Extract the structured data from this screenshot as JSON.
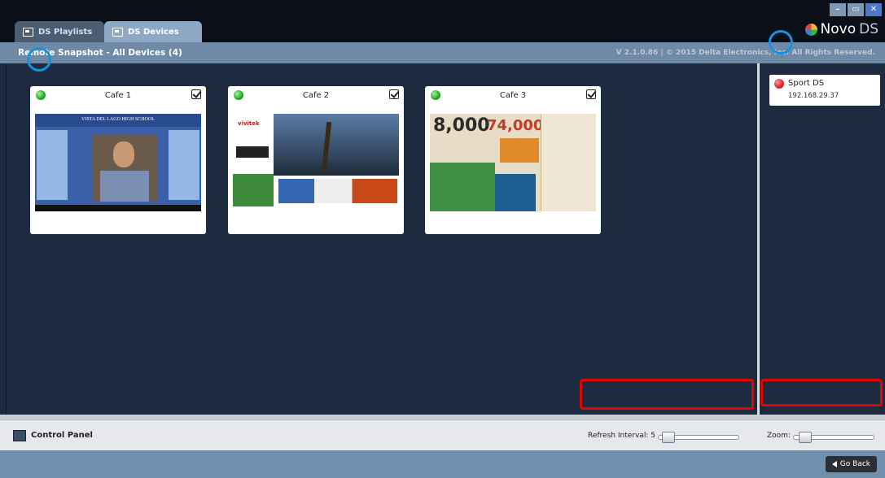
{
  "window": {
    "tabs": [
      {
        "label": "DS Playlists",
        "active": false
      },
      {
        "label": "DS Devices",
        "active": true
      }
    ],
    "logo": {
      "prefix": "Novo",
      "suffix": "DS"
    },
    "controls": {
      "minimize": "–",
      "maximize": "▭",
      "close": "✕"
    }
  },
  "header": {
    "title": "Remote Snapshot - All Devices (4)",
    "version": "V 2.1.0.86  |  © 2015 Delta Electronics, Inc. All Rights Reserved."
  },
  "devices": [
    {
      "name": "Cafe 1",
      "status": "online",
      "checked": true
    },
    {
      "name": "Cafe 2",
      "status": "online",
      "checked": true
    },
    {
      "name": "Cafe 3",
      "status": "online",
      "checked": true
    }
  ],
  "thumb_text": {
    "cafe1_band": "VISTA DEL LAGO HIGH SCHOOL",
    "cafe2_brand": "vivitek",
    "cafe3_big": "8,000",
    "cafe3_big2": "74,000"
  },
  "side_devices": [
    {
      "name": "Sport DS",
      "ip": "192.168.29.37",
      "status": "offline"
    }
  ],
  "control_panel": {
    "label": "Control Panel",
    "refresh_label": "Refresh Interval: 5",
    "refresh_value": 5,
    "zoom_label": "Zoom:"
  },
  "footer": {
    "go_back_label": "Go Back"
  },
  "colors": {
    "background": "#1e2a40",
    "header": "#6f8aa6",
    "online": "#27a52b",
    "offline": "#d8212a",
    "annotation_red": "#e10600",
    "annotation_blue": "#1b90e0"
  }
}
